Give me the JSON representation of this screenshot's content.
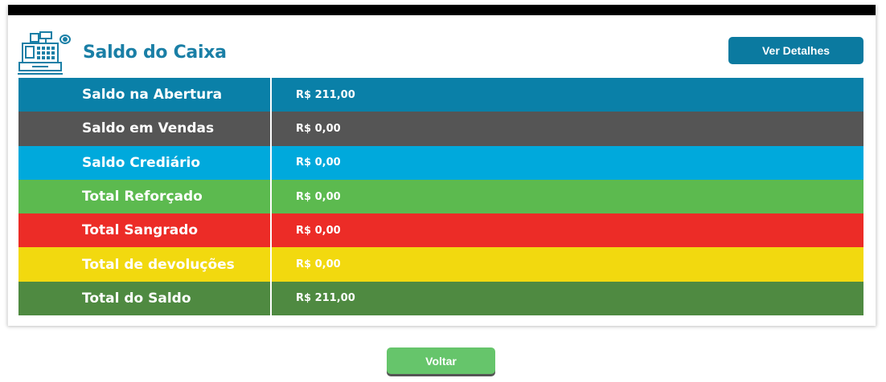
{
  "header": {
    "title": "Saldo do Caixa",
    "icon": "cash-register-icon",
    "details_label": "Ver Detalhes"
  },
  "rows": [
    {
      "label": "Saldo na Abertura",
      "value": "R$ 211,00",
      "color": "#0a80a8"
    },
    {
      "label": "Saldo em Vendas",
      "value": "R$ 0,00",
      "color": "#555555"
    },
    {
      "label": "Saldo Crediário",
      "value": "R$ 0,00",
      "color": "#00a9dc"
    },
    {
      "label": "Total Reforçado",
      "value": "R$ 0,00",
      "color": "#5cba4f"
    },
    {
      "label": "Total Sangrado",
      "value": "R$ 0,00",
      "color": "#ec2c27"
    },
    {
      "label": "Total de devoluções",
      "value": "R$ 0,00",
      "color": "#f2d90f"
    },
    {
      "label": "Total do Saldo",
      "value": "R$ 211,00",
      "color": "#4f8a41"
    }
  ],
  "footer": {
    "back_label": "Voltar"
  },
  "colors": {
    "accent": "#1a7fa6",
    "details_button": "#0b7aa0",
    "back_button": "#66c56b"
  }
}
